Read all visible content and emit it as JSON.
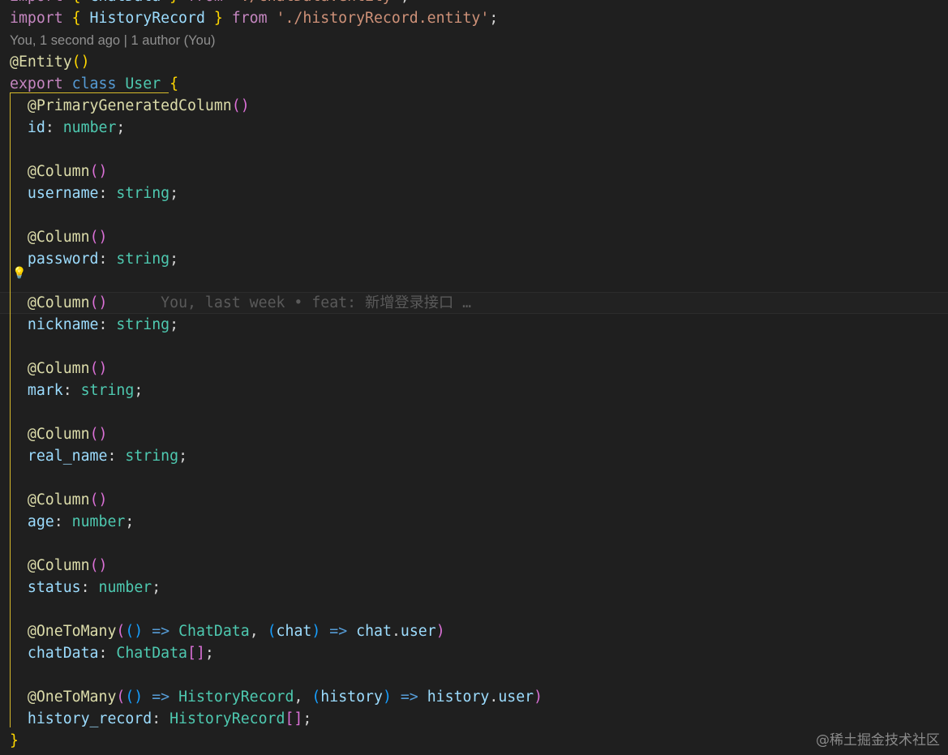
{
  "editor": {
    "lines": [
      [
        [
          "import",
          "kw"
        ],
        [
          " ",
          "pl"
        ],
        [
          "{",
          "br1"
        ],
        [
          " ChatData ",
          "id"
        ],
        [
          "}",
          "br1"
        ],
        [
          " ",
          "pl"
        ],
        [
          "from",
          "kw"
        ],
        [
          " ",
          "pl"
        ],
        [
          "'./chatData.entity'",
          "str"
        ],
        [
          ";",
          "pl"
        ]
      ],
      [
        [
          "import",
          "kw"
        ],
        [
          " ",
          "pl"
        ],
        [
          "{",
          "br1"
        ],
        [
          " HistoryRecord ",
          "id"
        ],
        [
          "}",
          "br1"
        ],
        [
          " ",
          "pl"
        ],
        [
          "from",
          "kw"
        ],
        [
          " ",
          "pl"
        ],
        [
          "'./historyRecord.entity'",
          "str"
        ],
        [
          ";",
          "pl"
        ]
      ],
      [
        [
          "You, 1 second ago | 1 author (You)",
          "lens"
        ]
      ],
      [
        [
          "@Entity",
          "dec"
        ],
        [
          "()",
          "br1"
        ]
      ],
      [
        [
          "export",
          "kw"
        ],
        [
          " ",
          "pl"
        ],
        [
          "class",
          "cls"
        ],
        [
          " ",
          "pl"
        ],
        [
          "User",
          "type"
        ],
        [
          " ",
          "pl"
        ],
        [
          "{",
          "br1"
        ]
      ],
      [
        [
          "  @PrimaryGeneratedColumn",
          "dec"
        ],
        [
          "()",
          "br2"
        ]
      ],
      [
        [
          "  id",
          "id"
        ],
        [
          ": ",
          "pl"
        ],
        [
          "number",
          "type"
        ],
        [
          ";",
          "pl"
        ]
      ],
      [
        [
          "",
          "pl"
        ]
      ],
      [
        [
          "  @Column",
          "dec"
        ],
        [
          "()",
          "br2"
        ]
      ],
      [
        [
          "  username",
          "id"
        ],
        [
          ": ",
          "pl"
        ],
        [
          "string",
          "type"
        ],
        [
          ";",
          "pl"
        ]
      ],
      [
        [
          "",
          "pl"
        ]
      ],
      [
        [
          "  @Column",
          "dec"
        ],
        [
          "()",
          "br2"
        ]
      ],
      [
        [
          "  password",
          "id"
        ],
        [
          ": ",
          "pl"
        ],
        [
          "string",
          "type"
        ],
        [
          ";",
          "pl"
        ]
      ],
      [
        [
          "",
          "pl"
        ]
      ],
      [
        [
          "  @Column",
          "dec"
        ],
        [
          "()",
          "br2"
        ],
        [
          "      You, last week • feat: 新增登录接口 …",
          "blame"
        ]
      ],
      [
        [
          "  nickname",
          "id"
        ],
        [
          ": ",
          "pl"
        ],
        [
          "string",
          "type"
        ],
        [
          ";",
          "pl"
        ]
      ],
      [
        [
          "",
          "pl"
        ]
      ],
      [
        [
          "  @Column",
          "dec"
        ],
        [
          "()",
          "br2"
        ]
      ],
      [
        [
          "  mark",
          "id"
        ],
        [
          ": ",
          "pl"
        ],
        [
          "string",
          "type"
        ],
        [
          ";",
          "pl"
        ]
      ],
      [
        [
          "",
          "pl"
        ]
      ],
      [
        [
          "  @Column",
          "dec"
        ],
        [
          "()",
          "br2"
        ]
      ],
      [
        [
          "  real_name",
          "id"
        ],
        [
          ": ",
          "pl"
        ],
        [
          "string",
          "type"
        ],
        [
          ";",
          "pl"
        ]
      ],
      [
        [
          "",
          "pl"
        ]
      ],
      [
        [
          "  @Column",
          "dec"
        ],
        [
          "()",
          "br2"
        ]
      ],
      [
        [
          "  age",
          "id"
        ],
        [
          ": ",
          "pl"
        ],
        [
          "number",
          "type"
        ],
        [
          ";",
          "pl"
        ]
      ],
      [
        [
          "",
          "pl"
        ]
      ],
      [
        [
          "  @Column",
          "dec"
        ],
        [
          "()",
          "br2"
        ]
      ],
      [
        [
          "  status",
          "id"
        ],
        [
          ": ",
          "pl"
        ],
        [
          "number",
          "type"
        ],
        [
          ";",
          "pl"
        ]
      ],
      [
        [
          "",
          "pl"
        ]
      ],
      [
        [
          "  @OneToMany",
          "dec"
        ],
        [
          "(",
          "br2"
        ],
        [
          "()",
          "br3"
        ],
        [
          " ",
          "pl"
        ],
        [
          "=>",
          "ar"
        ],
        [
          " ",
          "pl"
        ],
        [
          "ChatData",
          "type"
        ],
        [
          ", ",
          "pl"
        ],
        [
          "(",
          "br3"
        ],
        [
          "chat",
          "id"
        ],
        [
          ")",
          "br3"
        ],
        [
          " ",
          "pl"
        ],
        [
          "=>",
          "ar"
        ],
        [
          " ",
          "pl"
        ],
        [
          "chat",
          "id"
        ],
        [
          ".",
          "pl"
        ],
        [
          "user",
          "id"
        ],
        [
          ")",
          "br2"
        ]
      ],
      [
        [
          "  chatData",
          "id"
        ],
        [
          ": ",
          "pl"
        ],
        [
          "ChatData",
          "type"
        ],
        [
          "[]",
          "br2"
        ],
        [
          ";",
          "pl"
        ]
      ],
      [
        [
          "",
          "pl"
        ]
      ],
      [
        [
          "  @OneToMany",
          "dec"
        ],
        [
          "(",
          "br2"
        ],
        [
          "()",
          "br3"
        ],
        [
          " ",
          "pl"
        ],
        [
          "=>",
          "ar"
        ],
        [
          " ",
          "pl"
        ],
        [
          "HistoryRecord",
          "type"
        ],
        [
          ", ",
          "pl"
        ],
        [
          "(",
          "br3"
        ],
        [
          "history",
          "id"
        ],
        [
          ")",
          "br3"
        ],
        [
          " ",
          "pl"
        ],
        [
          "=>",
          "ar"
        ],
        [
          " ",
          "pl"
        ],
        [
          "history",
          "id"
        ],
        [
          ".",
          "pl"
        ],
        [
          "user",
          "id"
        ],
        [
          ")",
          "br2"
        ]
      ],
      [
        [
          "  history_record",
          "id"
        ],
        [
          ": ",
          "pl"
        ],
        [
          "HistoryRecord",
          "type"
        ],
        [
          "[]",
          "br2"
        ],
        [
          ";",
          "pl"
        ]
      ],
      [
        [
          "}",
          "br1"
        ]
      ]
    ],
    "current_line": 14
  },
  "watermark": "@稀土掘金技术社区",
  "icons": {
    "lightbulb": "lightbulb-icon"
  }
}
